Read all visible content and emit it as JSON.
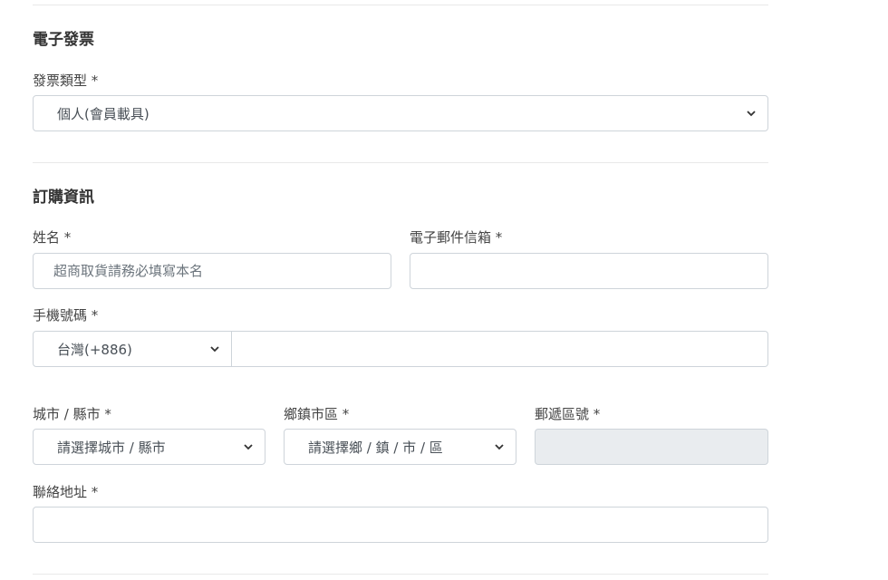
{
  "invoice": {
    "title": "電子發票",
    "type_label": "發票類型 *",
    "type_value": "個人(會員載具)"
  },
  "order": {
    "title": "訂購資訊",
    "name_label": "姓名 *",
    "name_placeholder": "超商取貨請務必填寫本名",
    "email_label": "電子郵件信箱 *",
    "phone_label": "手機號碼 *",
    "country_code_value": "台灣(+886)",
    "city_label": "城市 / 縣市 *",
    "city_value": "請選擇城市 / 縣市",
    "district_label": "鄉鎮市區 *",
    "district_value": "請選擇鄉 / 鎮 / 市 / 區",
    "zip_label": "郵遞區號 *",
    "address_label": "聯絡地址 *"
  },
  "icons": {
    "select_arrow": "chevron-down-icon"
  },
  "colors": {
    "border": "#ced4da",
    "disabled_bg": "#e9ecef",
    "divider": "#e9e9e9"
  }
}
